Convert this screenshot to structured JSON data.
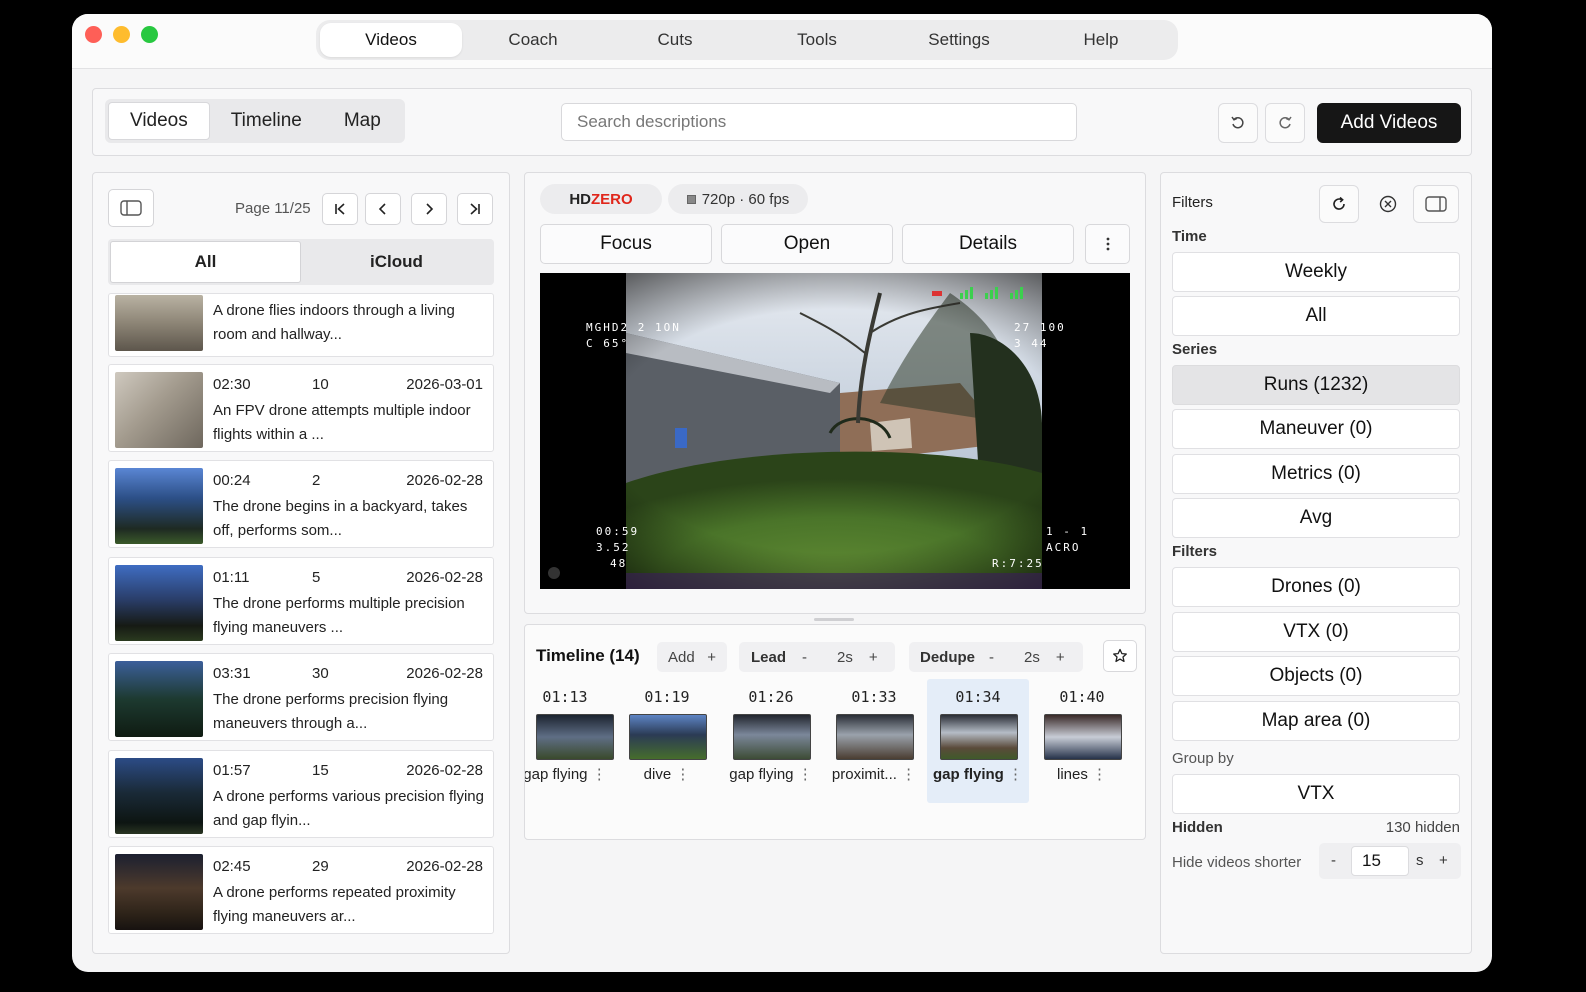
{
  "top_nav": {
    "tabs": [
      "Videos",
      "Coach",
      "Cuts",
      "Tools",
      "Settings",
      "Help"
    ]
  },
  "toolbar": {
    "views": [
      "Videos",
      "Timeline",
      "Map"
    ],
    "search_placeholder": "Search descriptions",
    "add_label": "Add Videos"
  },
  "left": {
    "page_label": "Page 11/25",
    "sources": [
      "All",
      "iCloud"
    ],
    "videos": [
      {
        "desc": "A drone flies indoors through a living room and hallway..."
      },
      {
        "duration": "02:30",
        "count": "10",
        "date": "2026-03-01",
        "desc": "An FPV drone attempts multiple indoor flights within a ..."
      },
      {
        "duration": "00:24",
        "count": "2",
        "date": "2026-02-28",
        "desc": "The drone begins in a backyard, takes off, performs som..."
      },
      {
        "duration": "01:11",
        "count": "5",
        "date": "2026-02-28",
        "desc": "The drone performs multiple precision flying maneuvers ..."
      },
      {
        "duration": "03:31",
        "count": "30",
        "date": "2026-02-28",
        "desc": "The drone performs precision flying maneuvers through a..."
      },
      {
        "duration": "01:57",
        "count": "15",
        "date": "2026-02-28",
        "desc": "A drone performs various precision flying and gap flyin..."
      },
      {
        "duration": "02:45",
        "count": "29",
        "date": "2026-02-28",
        "desc": "A drone performs repeated proximity flying maneuvers ar..."
      }
    ]
  },
  "center": {
    "brand_hd": "HD",
    "brand_zero": "ZERO",
    "format": "720p · 60 fps",
    "actions": [
      "Focus",
      "Open",
      "Details"
    ],
    "osd": {
      "top_left_1": "MGHD2  2 1ON",
      "top_left_2": "C    65°",
      "top_right_1": "27  100",
      "top_right_2": "3  44",
      "bottom_left_1": "00:59",
      "bottom_left_2": "3.52",
      "bottom_left_3": "48",
      "bottom_right_1": "1 - 1",
      "bottom_right_2": "ACRO",
      "bottom_right_3": "R:7:25"
    }
  },
  "timeline": {
    "title": "Timeline (14)",
    "add_label": "Add",
    "lead_label": "Lead",
    "lead_value": "2s",
    "dedupe_label": "Dedupe",
    "dedupe_value": "2s",
    "minus": "-",
    "plus": "+",
    "clips": [
      {
        "time": "01:13",
        "label": "gap flying"
      },
      {
        "time": "01:19",
        "label": "dive"
      },
      {
        "time": "01:26",
        "label": "gap flying"
      },
      {
        "time": "01:33",
        "label": "proximit..."
      },
      {
        "time": "01:34",
        "label": "gap flying",
        "selected": true
      },
      {
        "time": "01:40",
        "label": "lines"
      }
    ]
  },
  "right": {
    "title": "Filters",
    "time_label": "Time",
    "time_options": [
      "Weekly",
      "All"
    ],
    "series_label": "Series",
    "series": [
      "Runs (1232)",
      "Maneuver (0)",
      "Metrics (0)",
      "Avg"
    ],
    "filters_label": "Filters",
    "filters": [
      "Drones (0)",
      "VTX (0)",
      "Objects (0)",
      "Map area (0)"
    ],
    "group_by_label": "Group by",
    "group_by_value": "VTX",
    "hidden_label": "Hidden",
    "hidden_count": "130 hidden",
    "hide_shorter_label": "Hide videos shorter",
    "hide_shorter_value": "15",
    "hide_shorter_unit": "s"
  },
  "colors": {
    "accent": "#161616",
    "brand_red": "#e0261b",
    "selected_clip": "#e4edf8"
  }
}
